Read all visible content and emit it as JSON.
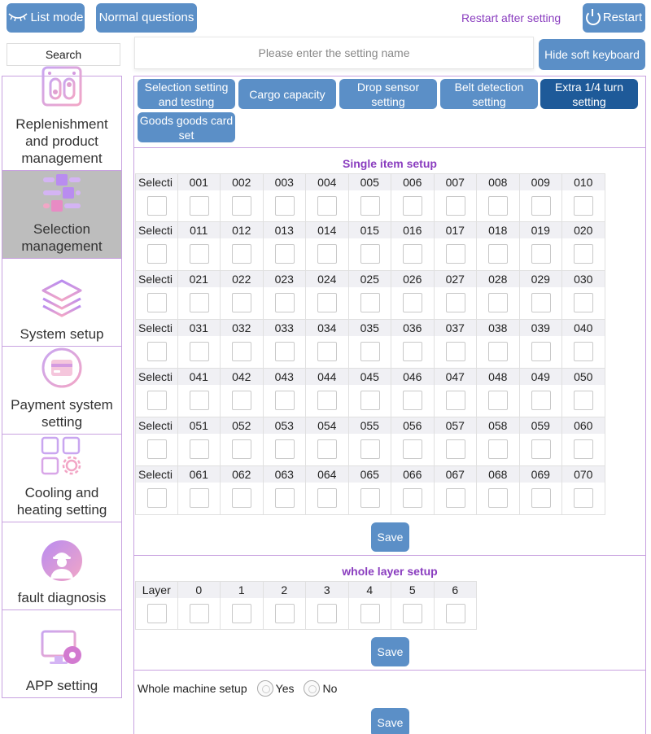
{
  "topbar": {
    "list_mode": "List mode",
    "normal_questions": "Normal questions",
    "restart_note": "Restart after setting",
    "restart": "Restart"
  },
  "search": {
    "label": "Search",
    "placeholder": "Please enter the setting name",
    "hide_keyboard": "Hide soft keyboard"
  },
  "sidebar": {
    "items": [
      {
        "label": "Replenishment and product management",
        "icon": "replenishment-icon"
      },
      {
        "label": "Selection management",
        "icon": "selection-icon"
      },
      {
        "label": "System setup",
        "icon": "layers-icon"
      },
      {
        "label": "Payment system setting",
        "icon": "card-icon"
      },
      {
        "label": "Cooling and heating setting",
        "icon": "grid-gear-icon"
      },
      {
        "label": "fault diagnosis",
        "icon": "worker-icon"
      },
      {
        "label": "APP setting",
        "icon": "monitor-gear-icon"
      }
    ],
    "active": "Selection management"
  },
  "tabs": [
    {
      "label": "Selection setting and testing",
      "active": false
    },
    {
      "label": "Cargo capacity",
      "active": false
    },
    {
      "label": "Drop sensor setting",
      "active": false
    },
    {
      "label": "Belt detection setting",
      "active": false
    },
    {
      "label": "Extra 1/4 turn setting",
      "active": true
    },
    {
      "label": "Goods goods card set",
      "active": false
    }
  ],
  "single_item": {
    "title": "Single item setup",
    "row_label": "Selecti",
    "rows": [
      [
        "001",
        "002",
        "003",
        "004",
        "005",
        "006",
        "007",
        "008",
        "009",
        "010"
      ],
      [
        "011",
        "012",
        "013",
        "014",
        "015",
        "016",
        "017",
        "018",
        "019",
        "020"
      ],
      [
        "021",
        "022",
        "023",
        "024",
        "025",
        "026",
        "027",
        "028",
        "029",
        "030"
      ],
      [
        "031",
        "032",
        "033",
        "034",
        "035",
        "036",
        "037",
        "038",
        "039",
        "040"
      ],
      [
        "041",
        "042",
        "043",
        "044",
        "045",
        "046",
        "047",
        "048",
        "049",
        "050"
      ],
      [
        "051",
        "052",
        "053",
        "054",
        "055",
        "056",
        "057",
        "058",
        "059",
        "060"
      ],
      [
        "061",
        "062",
        "063",
        "064",
        "065",
        "066",
        "067",
        "068",
        "069",
        "070"
      ]
    ],
    "save": "Save"
  },
  "whole_layer": {
    "title": "whole layer setup",
    "row_label": "Layer",
    "layers": [
      "0",
      "1",
      "2",
      "3",
      "4",
      "5",
      "6"
    ],
    "save": "Save"
  },
  "whole_machine": {
    "label": "Whole machine setup",
    "yes": "Yes",
    "no": "No",
    "save": "Save"
  },
  "colors": {
    "button": "#5b8fc7",
    "active_tab": "#1e5a99",
    "accent_purple": "#8a3dbf",
    "sidebar_active": "#bdbdbd"
  }
}
